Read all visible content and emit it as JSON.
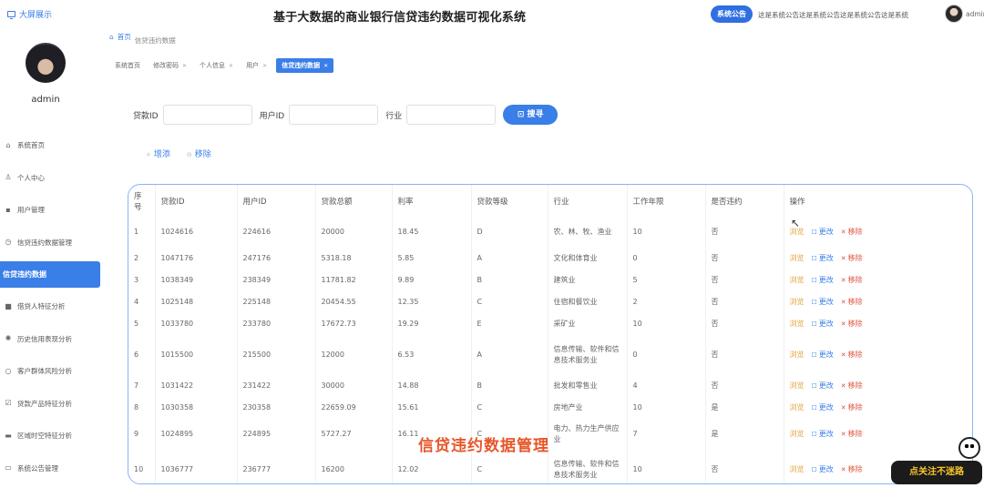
{
  "header": {
    "big_screen_label": "大屏展示",
    "title": "基于大数据的商业银行信贷违约数据可视化系统",
    "notice_button": "系统公告",
    "notice_text": "这是系统公告这是系统公告这是系统公告这是系统",
    "user": "admin"
  },
  "sidebar": {
    "username": "admin",
    "items": [
      {
        "label": "系统首页",
        "icon": "home-icon"
      },
      {
        "label": "个人中心",
        "icon": "user-icon"
      },
      {
        "label": "用户管理",
        "icon": "user-manage-icon"
      },
      {
        "label": "信贷违约数据管理",
        "icon": "circle-icon"
      },
      {
        "label": "信贷违约数据",
        "icon": ""
      },
      {
        "label": "借贷人特征分析",
        "icon": "video-icon"
      },
      {
        "label": "历史信用表现分析",
        "icon": "gear-icon"
      },
      {
        "label": "客户群体风险分析",
        "icon": "circle-icon"
      },
      {
        "label": "贷款产品特征分析",
        "icon": "checkbox-icon"
      },
      {
        "label": "区域时空特征分析",
        "icon": "monitor-icon"
      },
      {
        "label": "系统公告管理",
        "icon": "message-icon"
      }
    ]
  },
  "breadcrumb": {
    "home": "首页",
    "current": "信贷违约数据"
  },
  "tags": [
    {
      "label": "系统首页"
    },
    {
      "label": "修改密码"
    },
    {
      "label": "个人信息"
    },
    {
      "label": "用户"
    },
    {
      "label": "信贷违约数据"
    }
  ],
  "search": {
    "loan_id_label": "贷款ID",
    "user_id_label": "用户ID",
    "industry_label": "行业",
    "button": "搜寻"
  },
  "actions": {
    "add": "增添",
    "remove": "移除"
  },
  "table": {
    "headers": [
      "序号",
      "贷款ID",
      "用户ID",
      "贷款总额",
      "利率",
      "贷款等级",
      "行业",
      "工作年限",
      "是否违约",
      "操作"
    ],
    "ops": {
      "view": "浏览",
      "edit": "更改",
      "delete": "移除"
    },
    "rows": [
      [
        "1",
        "1024616",
        "224616",
        "20000",
        "18.45",
        "D",
        "农、林、牧、渔业",
        "10",
        "否"
      ],
      [
        "2",
        "1047176",
        "247176",
        "5318.18",
        "5.85",
        "A",
        "文化和体育业",
        "0",
        "否"
      ],
      [
        "3",
        "1038349",
        "238349",
        "11781.82",
        "9.89",
        "B",
        "建筑业",
        "5",
        "否"
      ],
      [
        "4",
        "1025148",
        "225148",
        "20454.55",
        "12.35",
        "C",
        "住宿和餐饮业",
        "2",
        "否"
      ],
      [
        "5",
        "1033780",
        "233780",
        "17672.73",
        "19.29",
        "E",
        "采矿业",
        "10",
        "否"
      ],
      [
        "6",
        "1015500",
        "215500",
        "12000",
        "6.53",
        "A",
        "信息传输、软件和信息技术服务业",
        "0",
        "否"
      ],
      [
        "7",
        "1031422",
        "231422",
        "30000",
        "14.88",
        "B",
        "批发和零售业",
        "4",
        "否"
      ],
      [
        "8",
        "1030358",
        "230358",
        "22659.09",
        "15.61",
        "C",
        "房地产业",
        "10",
        "是"
      ],
      [
        "9",
        "1024895",
        "224895",
        "5727.27",
        "16.11",
        "C",
        "电力、热力生产供应业",
        "7",
        "是"
      ],
      [
        "10",
        "1036777",
        "236777",
        "16200",
        "12.02",
        "C",
        "信息传输、软件和信息技术服务业",
        "10",
        "否"
      ]
    ]
  },
  "overlay_title": "信贷违约数据管理",
  "badge_text": "点关注不迷路",
  "colors": {
    "primary": "#3a7ee8",
    "view": "#e6a23c",
    "delete": "#e0533c",
    "overlay": "#e8562a"
  }
}
